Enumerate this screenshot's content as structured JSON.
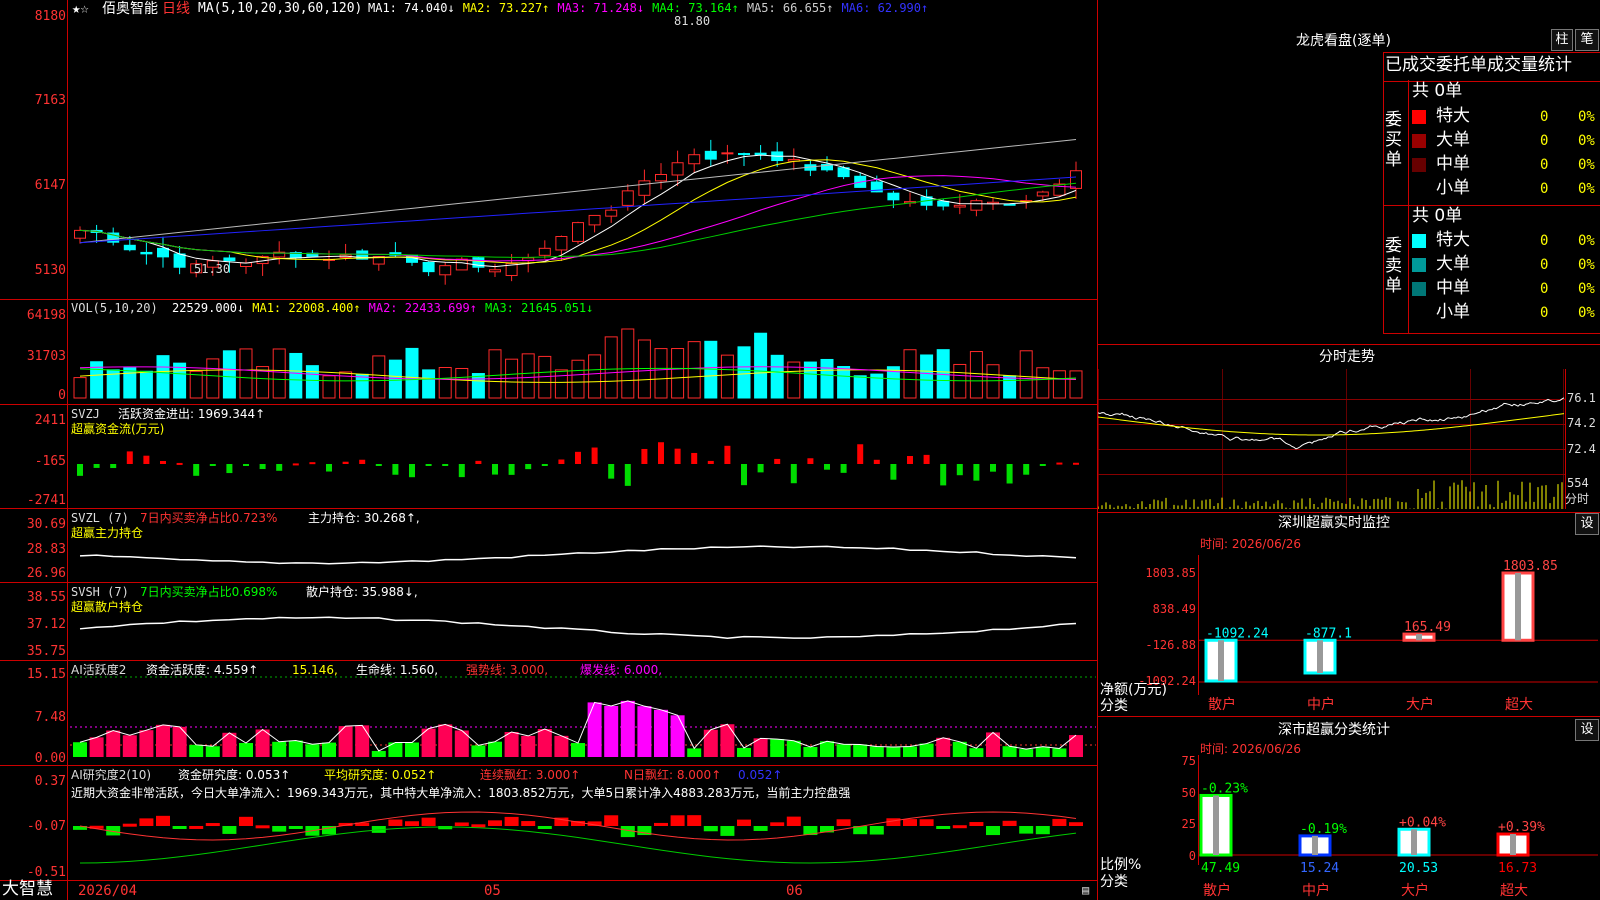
{
  "stock": {
    "name": "佰奥智能",
    "period": "日线"
  },
  "price_panel": {
    "ma_params": "MA(5,10,20,30,60,120)",
    "ma_values": [
      {
        "label": "MA1: 74.040↓",
        "color": "#ffffff"
      },
      {
        "label": "MA2: 73.227↑",
        "color": "#ffff00"
      },
      {
        "label": "MA3: 71.248↓",
        "color": "#ff00ff"
      },
      {
        "label": "MA4: 73.164↑",
        "color": "#00ff00"
      },
      {
        "label": "MA5: 66.655↑",
        "color": "#cccccc"
      },
      {
        "label": "MA6: 62.990↑",
        "color": "#3333ff"
      }
    ],
    "y_ticks": [
      "8180",
      "7163",
      "6147",
      "5130"
    ],
    "high_label": "81.80",
    "low_label": "51.30"
  },
  "vol_panel": {
    "title": "VOL(5,10,20)",
    "values": [
      {
        "label": "22529.000↓",
        "color": "#ffffff"
      },
      {
        "label": "MA1: 22008.400↑",
        "color": "#ffff00"
      },
      {
        "label": "MA2: 22433.699↑",
        "color": "#ff00ff"
      },
      {
        "label": "MA3: 21645.051↓",
        "color": "#00ff00"
      }
    ],
    "y_ticks": [
      "64198",
      "31703",
      "0"
    ]
  },
  "svzj_panel": {
    "title": "SVZJ",
    "line1": "活跃资金进出: 1969.344↑",
    "line2": "超赢资金流(万元)",
    "y_ticks": [
      "2411",
      "-165",
      "-2741"
    ]
  },
  "svzl_panel": {
    "title": "SVZL (7)",
    "ratio": "7日内买卖净占比0.723%",
    "hold": "主力持仓: 30.268↑,",
    "line2": "超赢主力持仓",
    "y_ticks": [
      "30.69",
      "28.83",
      "26.96"
    ]
  },
  "svsh_panel": {
    "title": "SVSH (7)",
    "ratio": "7日内买卖净占比0.698%",
    "hold": "散户持仓: 35.988↓,",
    "line2": "超赢散户持仓",
    "y_ticks": [
      "38.55",
      "37.12",
      "35.75"
    ]
  },
  "ai_active_panel": {
    "title": "AI活跃度2",
    "v1": "资金活跃度: 4.559↑",
    "v2": "15.146,",
    "v3": "生命线: 1.560,",
    "v4": "强势线: 3.000,",
    "v5": "爆发线: 6.000,",
    "y_ticks": [
      "15.15",
      "7.48",
      "0.00"
    ]
  },
  "ai_research_panel": {
    "title": "AI研究度2(10)",
    "v1": "资金研究度: 0.053↑",
    "v2": "平均研究度: 0.052↑",
    "v3": "连续飘红: 3.000↑",
    "v4": "N日飘红: 8.000↑",
    "v5": "0.052↑",
    "summary": "近期大资金非常活跃，今日大单净流入：1969.343万元，其中特大单净流入：1803.852万元，大单5日累计净入4883.283万元，当前主力控盘强",
    "y_ticks": [
      "0.37",
      "-0.07",
      "-0.51"
    ]
  },
  "bottom_bar": {
    "app_name": "大智慧",
    "date_start": "2026/04",
    "month5": "05",
    "month6": "06"
  },
  "dragon_tiger": {
    "title": "龙虎看盘(逐单)",
    "btn_bar": "柱",
    "btn_pen": "笔",
    "tabs": "已成交委托单成交量统计",
    "buy_label": "委买单",
    "sell_label": "委卖单",
    "buy_total": "共 0单",
    "sell_total": "共 0单",
    "buy_rows": [
      {
        "name": "特大",
        "count": "0",
        "pct": "0%",
        "color": "#ff0000"
      },
      {
        "name": "大单",
        "count": "0",
        "pct": "0%",
        "color": "#990000"
      },
      {
        "name": "中单",
        "count": "0",
        "pct": "0%",
        "color": "#660000"
      },
      {
        "name": "小单",
        "count": "0",
        "pct": "0%",
        "color": "#000000"
      }
    ],
    "sell_rows": [
      {
        "name": "特大",
        "count": "0",
        "pct": "0%",
        "color": "#00ffff"
      },
      {
        "name": "大单",
        "count": "0",
        "pct": "0%",
        "color": "#009999"
      },
      {
        "name": "中单",
        "count": "0",
        "pct": "0%",
        "color": "#007777"
      },
      {
        "name": "小单",
        "count": "0",
        "pct": "0%",
        "color": "#000000"
      }
    ]
  },
  "intraday": {
    "title": "分时走势",
    "ticks": [
      "76.1",
      "74.2",
      "72.4"
    ],
    "vol_tick": "554",
    "vol_unit": "分时"
  },
  "sz_monitor": {
    "title": "深圳超赢实时监控",
    "btn": "设",
    "time": "时间: 2026/06/26",
    "y_ticks": [
      "1803.85",
      "838.49",
      "-126.88",
      "-1092.24"
    ],
    "y_label": "净额(万元)",
    "x_label": "分类"
  },
  "sz_stats": {
    "title": "深市超赢分类统计",
    "btn": "设",
    "time": "时间: 2026/06/26",
    "y_ticks": [
      "75",
      "50",
      "25",
      "0"
    ],
    "y_label": "比例%",
    "x_label": "分类"
  },
  "chart_data": [
    {
      "type": "bar",
      "title": "深圳超赢实时监控",
      "ylabel": "净额(万元)",
      "xlabel": "分类",
      "categories": [
        "散户",
        "中户",
        "大户",
        "超大"
      ],
      "values": [
        -1092.24,
        -877.1,
        165.49,
        1803.85
      ],
      "value_labels": [
        "-1092.24",
        "-877.1",
        "165.49",
        "1803.85"
      ],
      "ylim": [
        -1092.24,
        1803.85
      ],
      "colors": [
        "#00ffff",
        "#00ffff",
        "#ff4444",
        "#ff4444"
      ]
    },
    {
      "type": "bar",
      "title": "深市超赢分类统计",
      "ylabel": "比例%",
      "xlabel": "分类",
      "categories": [
        "散户",
        "中户",
        "大户",
        "超大"
      ],
      "values": [
        47.49,
        15.24,
        20.53,
        16.73
      ],
      "value_labels": [
        "47.49",
        "15.24",
        "20.53",
        "16.73"
      ],
      "change_labels": [
        "-0.23%",
        "-0.19%",
        "+0.04%",
        "+0.39%"
      ],
      "change_colors": [
        "#00ff00",
        "#00ff00",
        "#ff4444",
        "#ff4444"
      ],
      "ylim": [
        0,
        75
      ],
      "colors": [
        "#00ff00",
        "#0033ff",
        "#00ffff",
        "#ff0000"
      ]
    }
  ]
}
